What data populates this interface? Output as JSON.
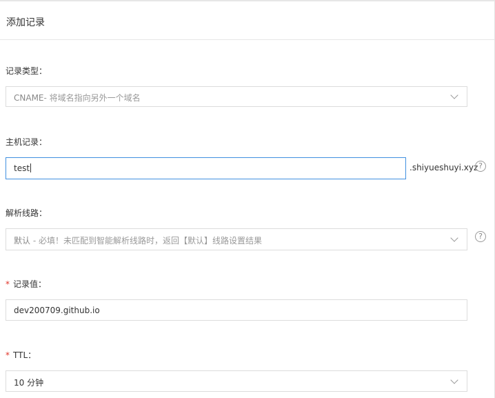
{
  "title": "添加记录",
  "record_type": {
    "label": "记录类型：",
    "value_main": "CNAME",
    "value_hint": "- 将域名指向另外一个域名"
  },
  "host_record": {
    "label": "主机记录：",
    "value": "test",
    "suffix": ".shiyueshuyi.xyz"
  },
  "resolve_line": {
    "label": "解析线路：",
    "value_main": "默认",
    "value_hint": " - 必填！未匹配到智能解析线路时，返回【默认】线路设置结果"
  },
  "record_value": {
    "required_mark": "*",
    "label": "记录值：",
    "value": "dev200709.github.io"
  },
  "ttl": {
    "required_mark": "*",
    "label": "TTL：",
    "value": "10 分钟"
  },
  "help_glyph": "?"
}
